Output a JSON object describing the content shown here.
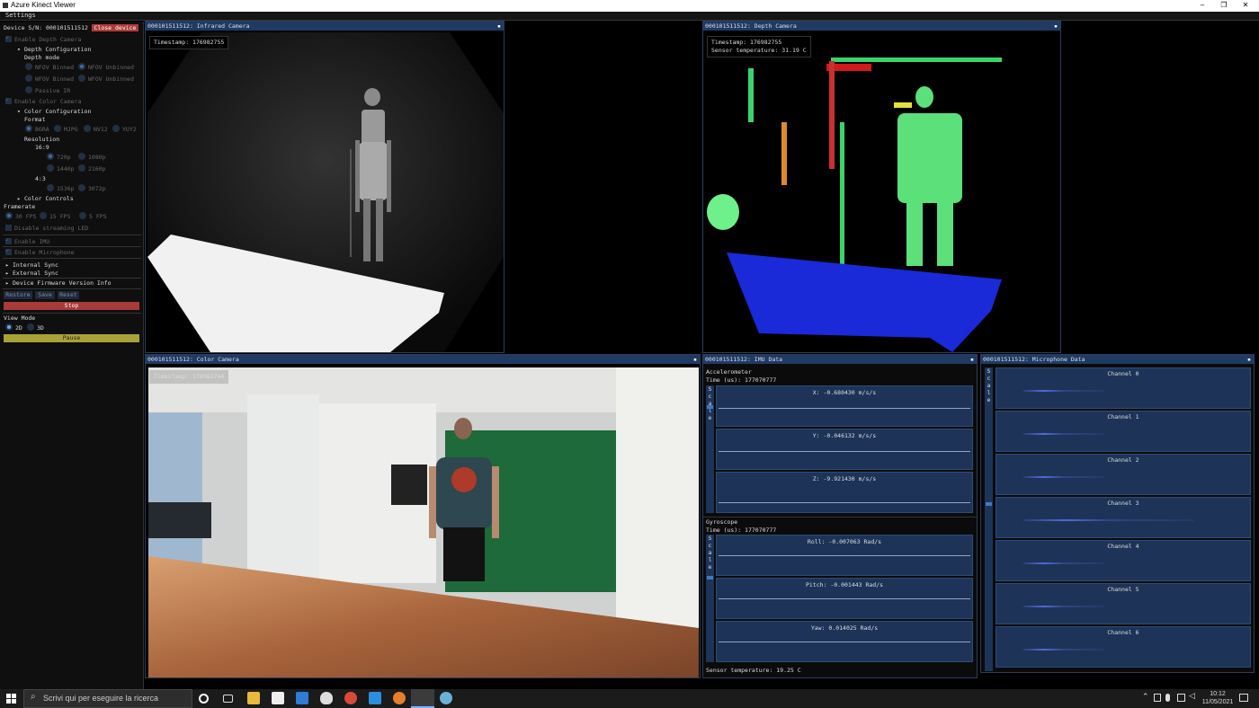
{
  "window": {
    "title": "Azure Kinect Viewer",
    "controls": [
      "–",
      "❐",
      "✕"
    ]
  },
  "menu": {
    "settings": "Settings"
  },
  "sidebar": {
    "device_label": "Device S/N: 000101511512",
    "close_device": "Close device",
    "enable_depth": "Enable Depth Camera",
    "depth_config": "Depth Configuration",
    "depth_mode": "Depth mode",
    "nfov_binned": "NFOV Binned",
    "nfov_unbinned": "NFOV Unbinned",
    "wfov_binned": "WFOV Binned",
    "wfov_unbinned": "WFOV Unbinned",
    "passive_ir": "Passive IR",
    "enable_color": "Enable Color Camera",
    "color_config": "Color Configuration",
    "format": "Format",
    "fmt_bgra": "BGRA",
    "fmt_mjpg": "MJPG",
    "fmt_nv12": "NV12",
    "fmt_yuy2": "YUY2",
    "resolution": "Resolution",
    "ratio_169": "16:9",
    "r720": "720p",
    "r1080": "1080p",
    "r1440": "1440p",
    "r2160": "2160p",
    "ratio_43": "4:3",
    "r1536": "1536p",
    "r3072": "3072p",
    "color_controls": "Color Controls",
    "framerate": "Framerate",
    "fps30": "30 FPS",
    "fps15": "15 FPS",
    "fps5": "5 FPS",
    "disable_led": "Disable streaming LED",
    "enable_imu": "Enable IMU",
    "enable_mic": "Enable Microphone",
    "internal_sync": "Internal Sync",
    "external_sync": "External Sync",
    "firmware": "Device Firmware Version Info",
    "restore": "Restore",
    "save": "Save",
    "reset": "Reset",
    "stop": "Stop",
    "view_mode": "View Mode",
    "v2d": "2D",
    "v3d": "3D",
    "pause": "Pause"
  },
  "ir_window": {
    "title": "000101511512: Infrared Camera",
    "timestamp": "Timestamp: 176982755"
  },
  "depth_window": {
    "title": "000101511512: Depth Camera",
    "timestamp": "Timestamp: 176982755",
    "temperature": "Sensor temperature: 31.19 C"
  },
  "color_window": {
    "title": "000101511512: Color Camera",
    "timestamp": "Timestamp: 176982744"
  },
  "imu_window": {
    "title": "000101511512: IMU Data",
    "accel_title": "Accelerometer",
    "accel_time": "Time (us): 177070777",
    "ax": "X:   -0.680430 m/s/s",
    "ay": "Y:   -0.046132 m/s/s",
    "az": "Z:   -9.921430 m/s/s",
    "gyro_title": "Gyroscope",
    "gyro_time": "Time (us): 177070777",
    "roll": "Roll:   -0.007063 Rad/s",
    "pitch": "Pitch:   -0.001443 Rad/s",
    "yaw": "Yaw:    0.014025 Rad/s",
    "temperature": "Sensor temperature: 19.25 C",
    "scale": [
      "S",
      "c",
      "a",
      "l",
      "e"
    ]
  },
  "mic_window": {
    "title": "000101511512: Microphone Data",
    "channels": [
      "Channel 0",
      "Channel 1",
      "Channel 2",
      "Channel 3",
      "Channel 4",
      "Channel 5",
      "Channel 6"
    ],
    "scale": [
      "S",
      "c",
      "a",
      "l",
      "e"
    ]
  },
  "taskbar": {
    "search_placeholder": "Scrivi qui per eseguire la ricerca",
    "time": "10:12",
    "date": "11/05/2021"
  }
}
